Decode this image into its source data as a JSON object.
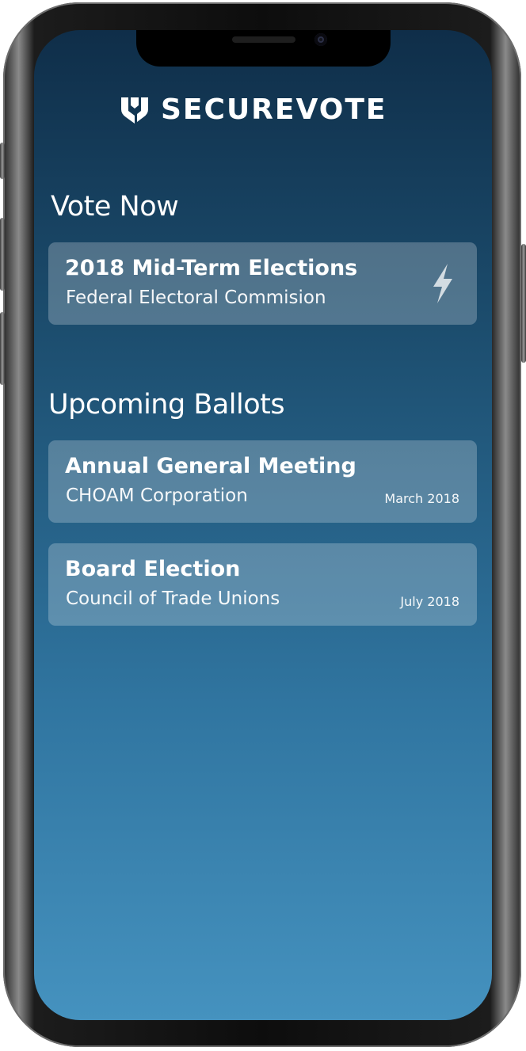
{
  "app": {
    "brand_name": "SECUREVOTE",
    "logo_icon": "shield-icon"
  },
  "vote_now": {
    "heading": "Vote Now",
    "items": [
      {
        "title": "2018 Mid-Term Elections",
        "organization": "Federal Electoral Commision",
        "icon": "lightning-bolt-icon"
      }
    ]
  },
  "upcoming": {
    "heading": "Upcoming Ballots",
    "items": [
      {
        "title": "Annual General Meeting",
        "organization": "CHOAM Corporation",
        "date": "March 2018"
      },
      {
        "title": "Board Election",
        "organization": "Council of Trade Unions",
        "date": "July 2018"
      }
    ]
  },
  "colors": {
    "background_top": "#0f2e49",
    "background_bottom": "#4592bf",
    "text": "#ffffff",
    "card": "rgba(255,255,255,0.24)"
  }
}
